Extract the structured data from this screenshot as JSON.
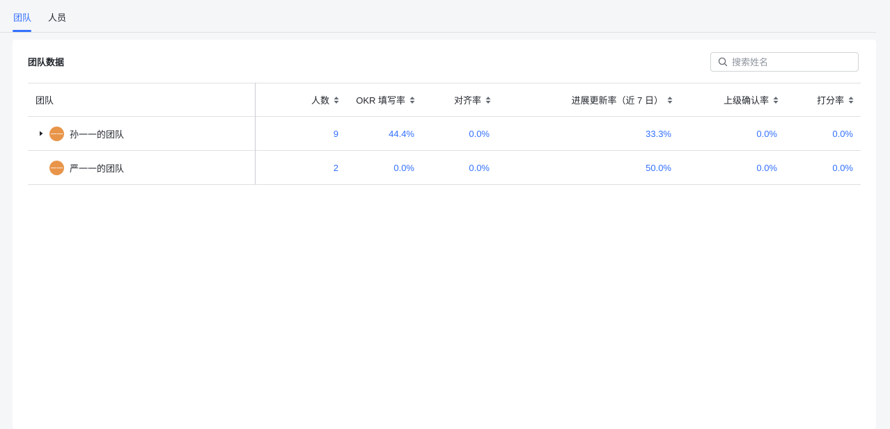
{
  "tabs": [
    {
      "label": "团队",
      "active": true
    },
    {
      "label": "人员",
      "active": false
    }
  ],
  "card": {
    "title": "团队数据",
    "search_placeholder": "搜索姓名"
  },
  "table": {
    "columns": [
      "团队",
      "人数",
      "OKR 填写率",
      "对齐率",
      "进展更新率（近 7 日）",
      "上级确认率",
      "打分率"
    ],
    "rows": [
      {
        "team": "孙一一的团队",
        "avatar": "一一",
        "expandable": true,
        "members": "9",
        "okr_fill": "44.4%",
        "align": "0.0%",
        "progress": "33.3%",
        "confirm": "0.0%",
        "score": "0.0%"
      },
      {
        "team": "严一一的团队",
        "avatar": "一一",
        "expandable": false,
        "members": "2",
        "okr_fill": "0.0%",
        "align": "0.0%",
        "progress": "50.0%",
        "confirm": "0.0%",
        "score": "0.0%"
      }
    ]
  },
  "colors": {
    "accent": "#3370ff",
    "avatar": "#e8954a"
  }
}
